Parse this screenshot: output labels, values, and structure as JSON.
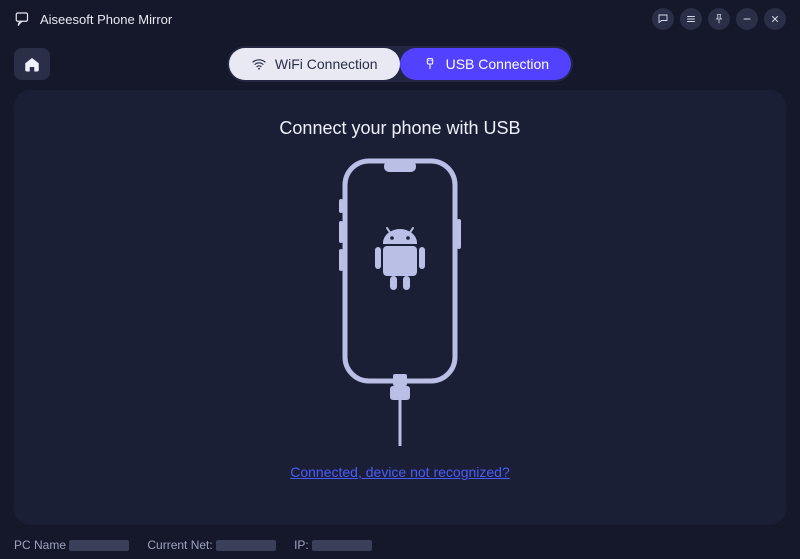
{
  "app": {
    "title": "Aiseesoft Phone Mirror"
  },
  "tabs": {
    "wifi_label": "WiFi Connection",
    "usb_label": "USB Connection"
  },
  "main": {
    "heading": "Connect your phone with USB",
    "help_link": "Connected, device not recognized?"
  },
  "footer": {
    "pc_name_label": "PC Name",
    "net_label": "Current Net:",
    "ip_label": "IP:"
  },
  "colors": {
    "accent": "#5241ff"
  }
}
